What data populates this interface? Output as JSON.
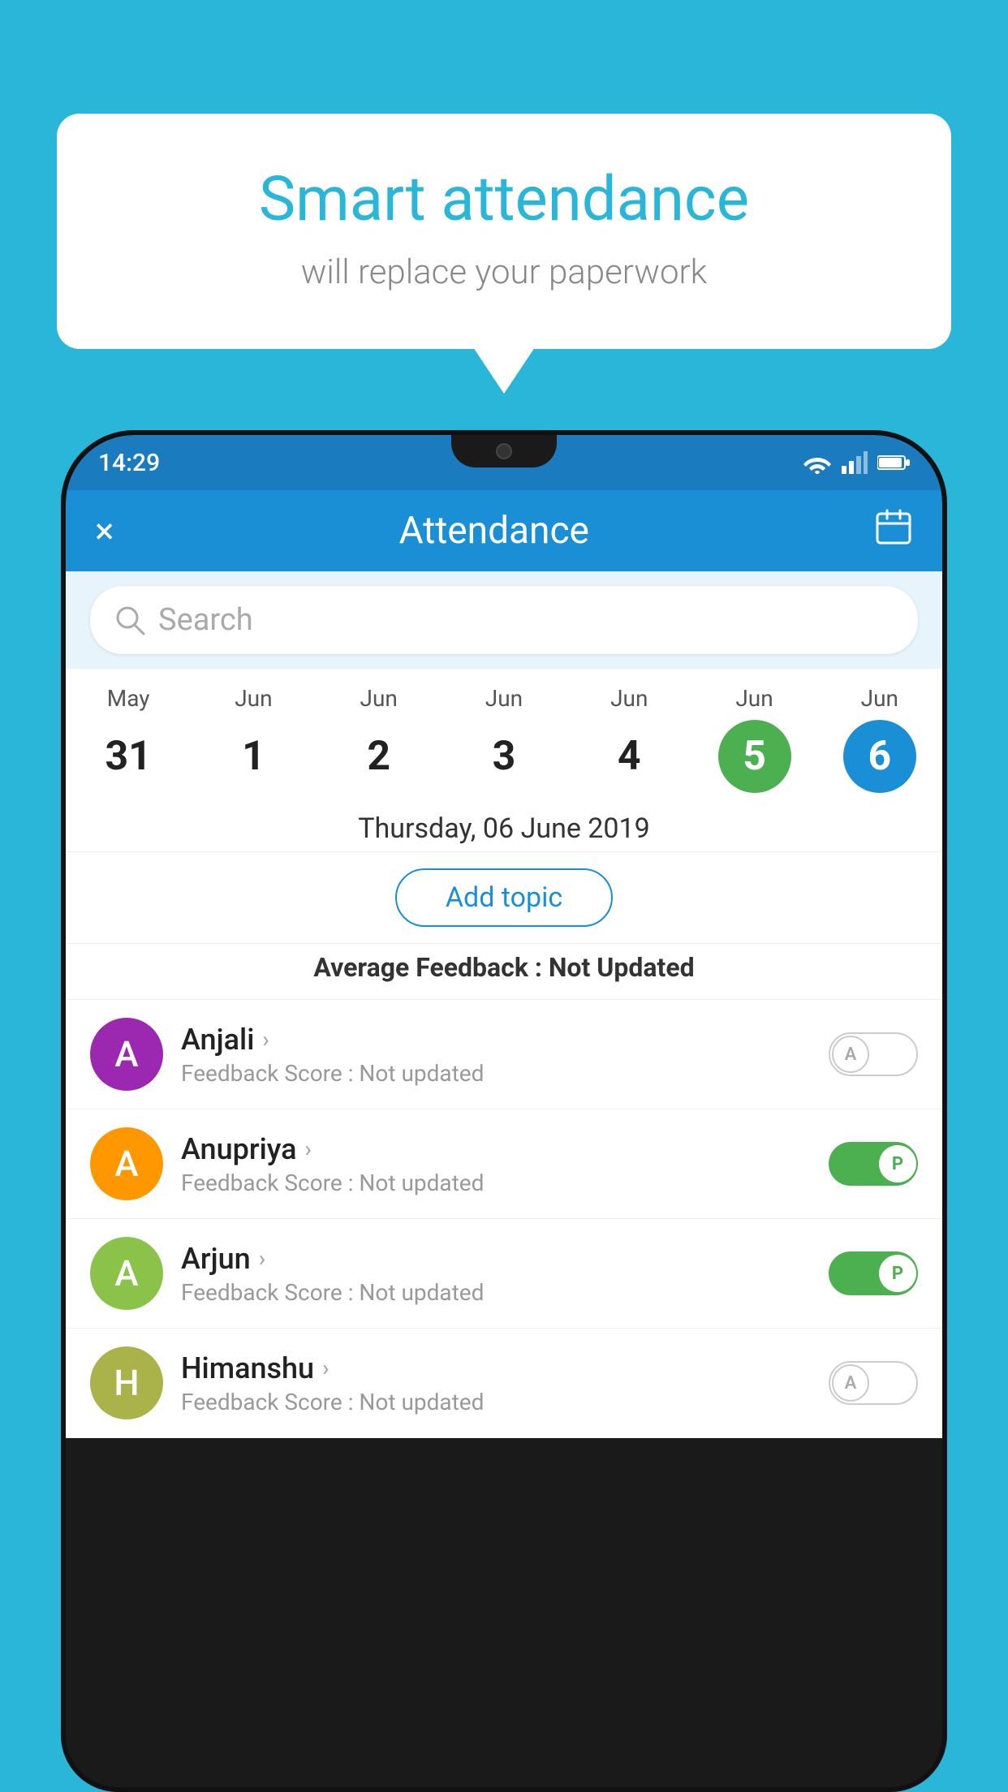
{
  "background_color": "#29b6d8",
  "speech_bubble": {
    "title": "Smart attendance",
    "subtitle": "will replace your paperwork"
  },
  "app": {
    "status_bar": {
      "time": "14:29"
    },
    "header": {
      "title": "Attendance",
      "close_label": "×",
      "calendar_icon": "calendar-icon"
    },
    "search": {
      "placeholder": "Search"
    },
    "calendar": {
      "days": [
        {
          "month": "May",
          "date": "31",
          "state": "normal"
        },
        {
          "month": "Jun",
          "date": "1",
          "state": "normal"
        },
        {
          "month": "Jun",
          "date": "2",
          "state": "normal"
        },
        {
          "month": "Jun",
          "date": "3",
          "state": "normal"
        },
        {
          "month": "Jun",
          "date": "4",
          "state": "normal"
        },
        {
          "month": "Jun",
          "date": "5",
          "state": "today"
        },
        {
          "month": "Jun",
          "date": "6",
          "state": "selected"
        }
      ]
    },
    "selected_date": "Thursday, 06 June 2019",
    "add_topic_label": "Add topic",
    "feedback_avg_label": "Average Feedback :",
    "feedback_avg_value": "Not Updated",
    "students": [
      {
        "name": "Anjali",
        "avatar_letter": "A",
        "avatar_color": "#9c27b0",
        "feedback_label": "Feedback Score :",
        "feedback_value": "Not updated",
        "attendance": "absent",
        "toggle_letter": "A"
      },
      {
        "name": "Anupriya",
        "avatar_letter": "A",
        "avatar_color": "#ff9800",
        "feedback_label": "Feedback Score :",
        "feedback_value": "Not updated",
        "attendance": "present",
        "toggle_letter": "P"
      },
      {
        "name": "Arjun",
        "avatar_letter": "A",
        "avatar_color": "#8bc34a",
        "feedback_label": "Feedback Score :",
        "feedback_value": "Not updated",
        "attendance": "present",
        "toggle_letter": "P"
      },
      {
        "name": "Himanshu",
        "avatar_letter": "H",
        "avatar_color": "#aab34a",
        "feedback_label": "Feedback Score :",
        "feedback_value": "Not updated",
        "attendance": "absent",
        "toggle_letter": "A"
      }
    ]
  }
}
